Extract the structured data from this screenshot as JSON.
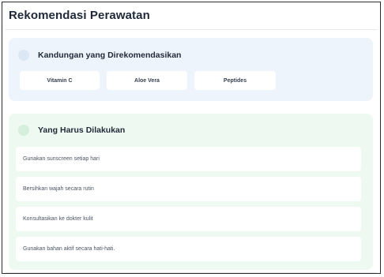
{
  "page": {
    "title": "Rekomendasi Perawatan"
  },
  "ingredients": {
    "title": "Kandungan yang Direkomendasikan",
    "icon": "circle-icon",
    "accent": "#eef4fb",
    "items": [
      {
        "label": "Vitamin C"
      },
      {
        "label": "Aloe Vera"
      },
      {
        "label": "Peptides"
      }
    ]
  },
  "todo": {
    "title": "Yang Harus Dilakukan",
    "icon": "circle-icon",
    "accent": "#eefaf1",
    "items": [
      {
        "label": "Gunakan sunscreen setiap hari"
      },
      {
        "label": "Bersihkan wajah secara rutin"
      },
      {
        "label": "Konsultasikan ke dokter kulit"
      },
      {
        "label": "Gunakan bahan aktif secara hati-hati."
      }
    ]
  }
}
